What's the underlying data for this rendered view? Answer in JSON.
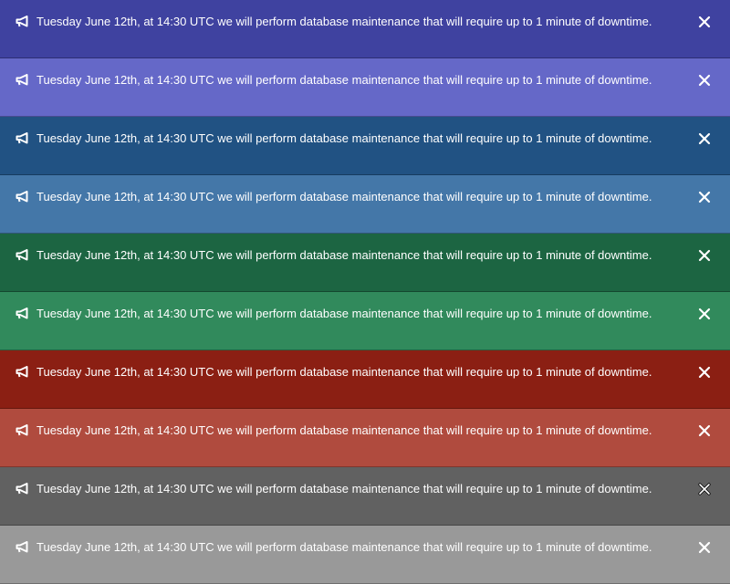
{
  "banners": [
    {
      "message": "Tuesday June 12th, at 14:30 UTC we will perform database maintenance that will require up to 1 minute of downtime.",
      "color": "#3f42a0",
      "icon": "megaphone-icon",
      "close_icon": "close-icon"
    },
    {
      "message": "Tuesday June 12th, at 14:30 UTC we will perform database maintenance that will require up to 1 minute of downtime.",
      "color": "#6568c8",
      "icon": "megaphone-icon",
      "close_icon": "close-icon"
    },
    {
      "message": "Tuesday June 12th, at 14:30 UTC we will perform database maintenance that will require up to 1 minute of downtime.",
      "color": "#215283",
      "icon": "megaphone-icon",
      "close_icon": "close-icon"
    },
    {
      "message": "Tuesday June 12th, at 14:30 UTC we will perform database maintenance that will require up to 1 minute of downtime.",
      "color": "#4477a8",
      "icon": "megaphone-icon",
      "close_icon": "close-icon"
    },
    {
      "message": "Tuesday June 12th, at 14:30 UTC we will perform database maintenance that will require up to 1 minute of downtime.",
      "color": "#1c6542",
      "icon": "megaphone-icon",
      "close_icon": "close-icon"
    },
    {
      "message": "Tuesday June 12th, at 14:30 UTC we will perform database maintenance that will require up to 1 minute of downtime.",
      "color": "#318a5c",
      "icon": "megaphone-icon",
      "close_icon": "close-icon"
    },
    {
      "message": "Tuesday June 12th, at 14:30 UTC we will perform database maintenance that will require up to 1 minute of downtime.",
      "color": "#8b1f13",
      "icon": "megaphone-icon",
      "close_icon": "close-icon"
    },
    {
      "message": "Tuesday June 12th, at 14:30 UTC we will perform database maintenance that will require up to 1 minute of downtime.",
      "color": "#b04b3e",
      "icon": "megaphone-icon",
      "close_icon": "close-icon"
    },
    {
      "message": "Tuesday June 12th, at 14:30 UTC we will perform database maintenance that will require up to 1 minute of downtime.",
      "color": "#616161",
      "icon": "megaphone-icon",
      "close_icon": "close-icon"
    },
    {
      "message": "Tuesday June 12th, at 14:30 UTC we will perform database maintenance that will require up to 1 minute of downtime.",
      "color": "#999999",
      "icon": "megaphone-icon",
      "close_icon": "close-icon"
    }
  ]
}
